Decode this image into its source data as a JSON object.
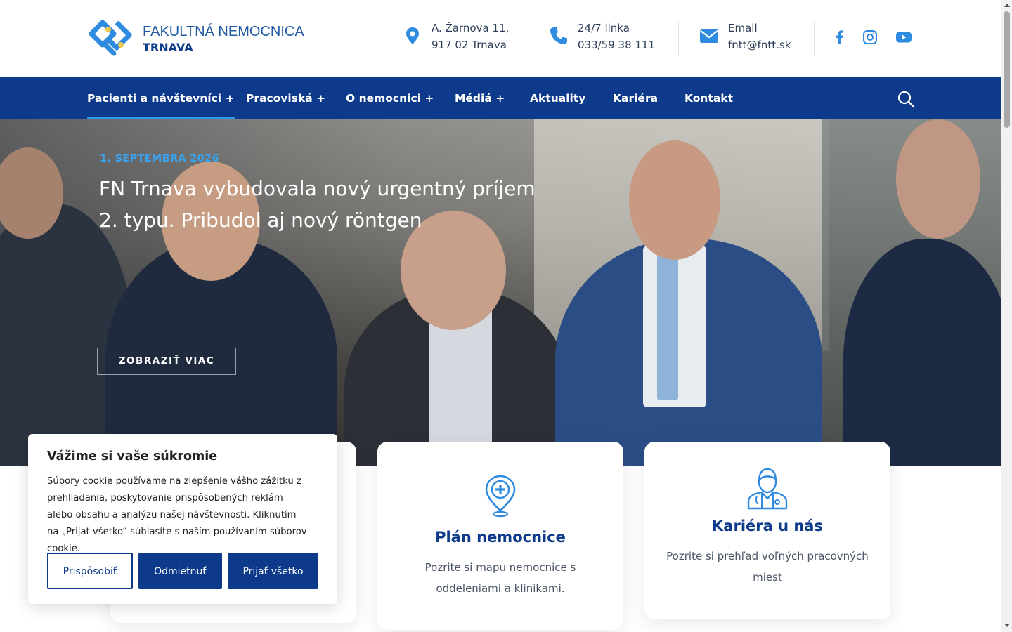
{
  "logo": {
    "line1": "FAKULTNÁ NEMOCNICA",
    "line2": "TRNAVA"
  },
  "contacts": [
    {
      "icon": "location-pin-icon",
      "line1": "A. Žarnova 11,",
      "line2": "917 02 Trnava"
    },
    {
      "icon": "phone-icon",
      "line1": "24/7 linka",
      "line2": "033/59 38 111"
    },
    {
      "icon": "envelope-icon",
      "line1": "Email",
      "line2": "fntt@fntt.sk"
    }
  ],
  "social": [
    "facebook-icon",
    "instagram-icon",
    "youtube-icon"
  ],
  "nav": {
    "items": [
      {
        "label": "Pacienti a návštevníci +",
        "active": true
      },
      {
        "label": "Pracoviská +"
      },
      {
        "label": "O nemocnici +"
      },
      {
        "label": "Médiá +"
      },
      {
        "label": "Aktuality"
      },
      {
        "label": "Kariéra"
      },
      {
        "label": "Kontakt"
      }
    ]
  },
  "hero": {
    "date": "1. SEPTEMBRA 2026",
    "title_line1": "FN Trnava vybudovala nový urgentný príjem",
    "title_line2": "2. typu. Pribudol aj nový röntgen",
    "button": "ZOBRAZIŤ VIAC"
  },
  "cards": [
    {
      "icon": "map-pin-cross-icon",
      "title": "Plán nemocnice",
      "desc_line1": "Pozrite si mapu nemocnice s",
      "desc_line2": "oddeleniami a klinikami."
    },
    {
      "icon": "doctor-icon",
      "title": "Kariéra u nás",
      "desc_line1": "Pozrite si prehľad voľných pracovných",
      "desc_line2": "miest"
    }
  ],
  "cookie": {
    "title": "Vážime si vaše súkromie",
    "text": "Súbory cookie používame na zlepšenie vášho zážitku z prehliadania, poskytovanie prispôsobených reklám alebo obsahu a analýzu našej návštevnosti. Kliknutím na „Prijať všetko“ súhlasíte s naším používaním súborov cookie.",
    "btn_customize": "Prispôsobiť",
    "btn_reject": "Odmietnuť",
    "btn_accept": "Prijať všetko"
  },
  "colors": {
    "brand": "#0d3a8a",
    "accent": "#2f9bec",
    "logo_yellow": "#f2c94c"
  }
}
